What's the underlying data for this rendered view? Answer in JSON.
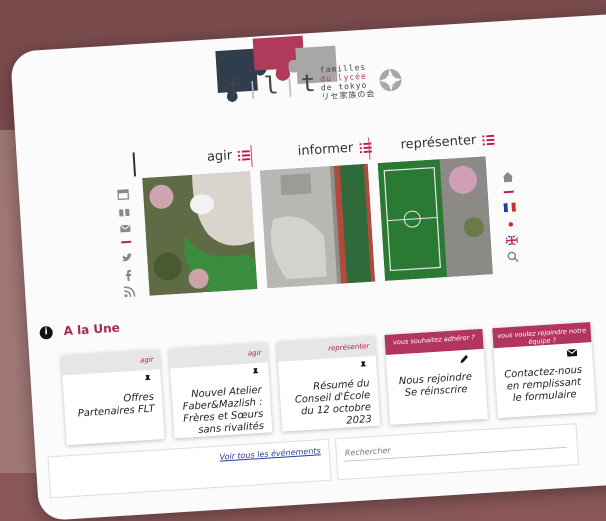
{
  "logo": {
    "letters": [
      "f",
      "l",
      "t"
    ],
    "text_lines": [
      "familles",
      "du lycée",
      "de tokyo",
      "リセ家族の会"
    ],
    "emblem": "rosette-icon"
  },
  "nav": {
    "items": [
      {
        "label": "agir",
        "icon": "list-icon"
      },
      {
        "label": "informer",
        "icon": "list-icon"
      },
      {
        "label": "représenter",
        "icon": "list-icon"
      }
    ]
  },
  "left_icons": [
    "calendar-icon",
    "gift-icon",
    "mail-icon",
    "dash",
    "twitter-icon",
    "facebook-icon",
    "rss-icon"
  ],
  "right_icons": [
    "home-icon",
    "dash",
    "flag-fr-icon",
    "flag-jp-icon",
    "flag-uk-icon",
    "search-icon"
  ],
  "section": {
    "title": "A la Une",
    "icon": "info-icon"
  },
  "tiles": [
    {
      "tag": "agir",
      "text": "Offres Partenaires FLT",
      "icon": "pin-icon"
    },
    {
      "tag": "agir",
      "text": "Nouvel Atelier Faber&Mazlish : Frères et Sœurs sans rivalités",
      "icon": "pin-icon"
    },
    {
      "tag": "représenter",
      "text": "Résumé du Conseil d'École du 12 octobre 2023",
      "icon": "pin-icon"
    },
    {
      "tag": "vous souhaitez adhérer ?",
      "text": "Nous rejoindre Se réinscrire",
      "icon": "pencil-icon"
    },
    {
      "tag": "vous voulez rejoindre notre équipe ?",
      "text": "Contactez-nous en remplissant le formulaire",
      "icon": "mail-icon"
    }
  ],
  "bottom": {
    "events_link": "Voir tous les événements",
    "search_placeholder": "Rechercher"
  },
  "colors": {
    "accent": "#b03a5b",
    "navy": "#2f3d4d",
    "grey": "#a7a7a7",
    "background": "#8a5858"
  }
}
